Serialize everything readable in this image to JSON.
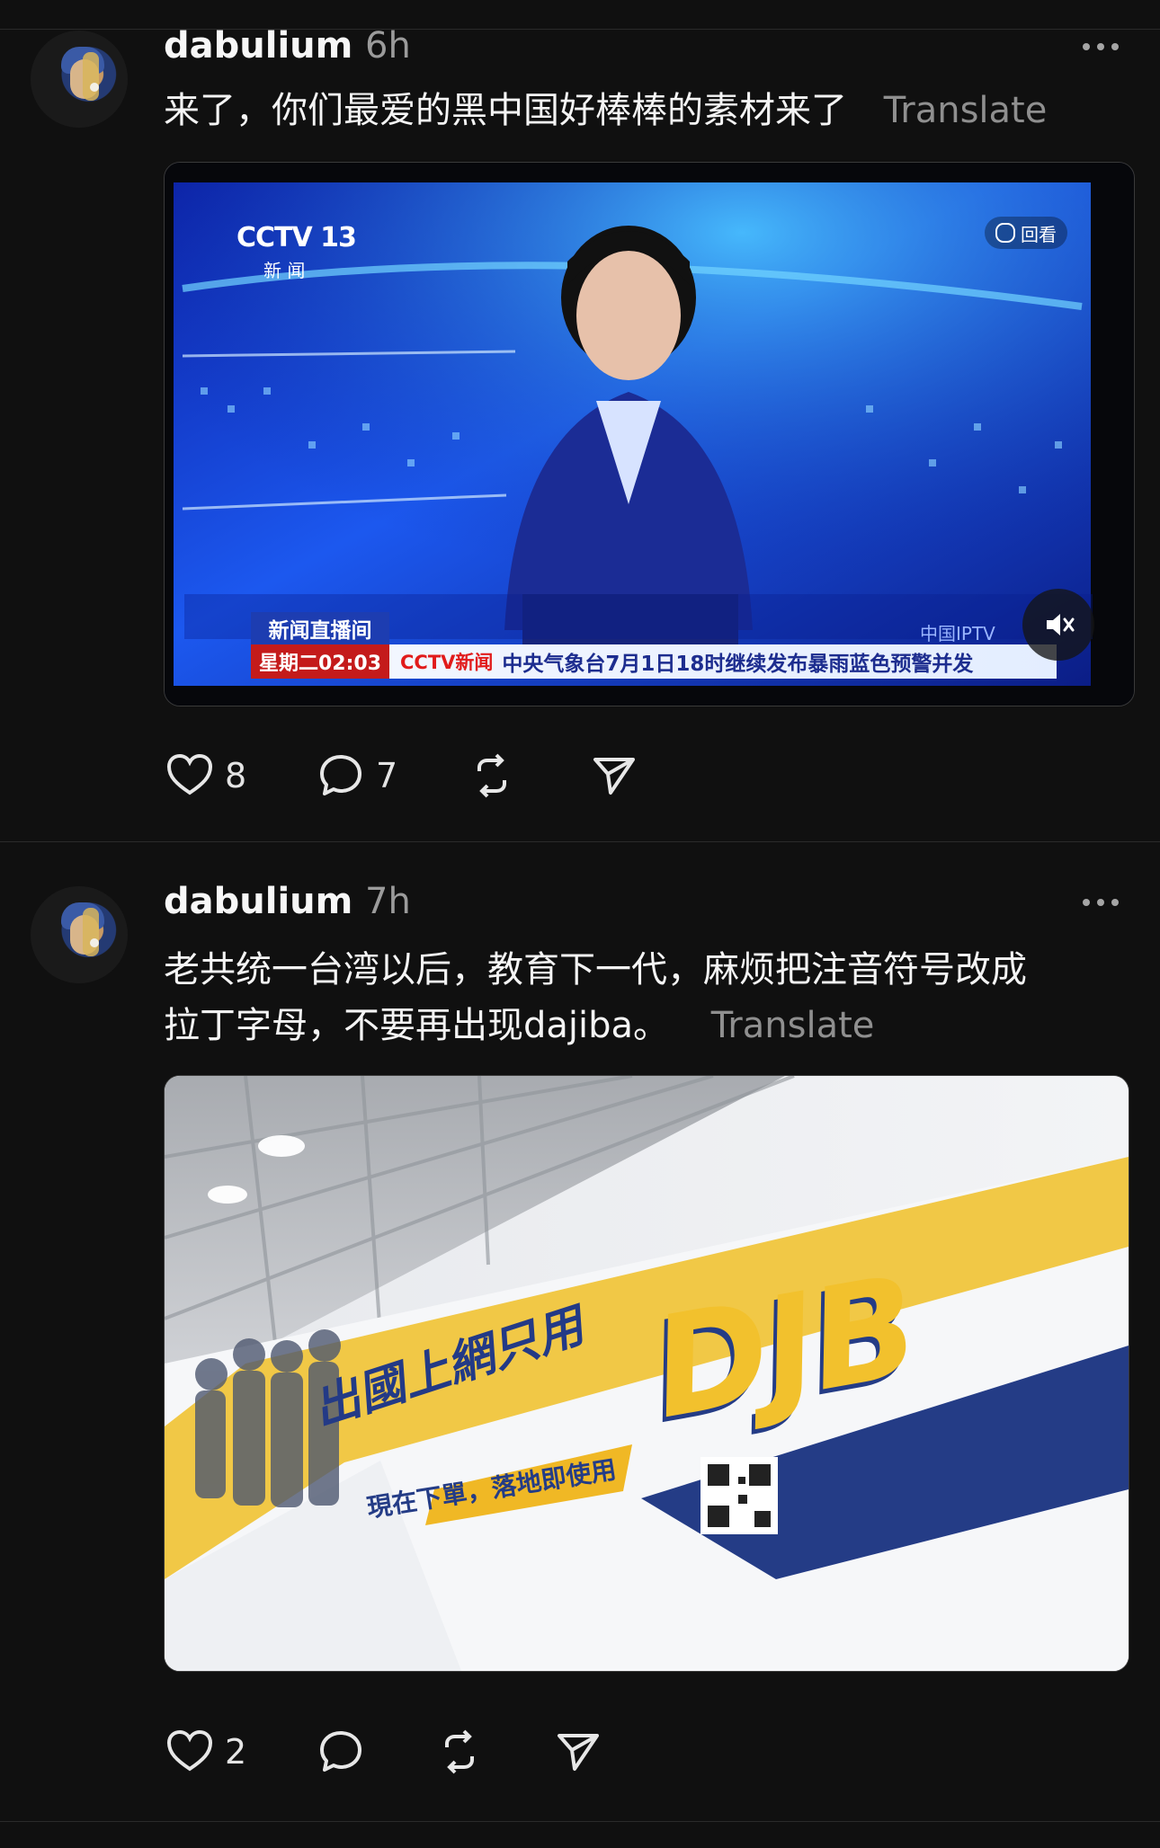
{
  "posts": [
    {
      "username": "dabulium",
      "time": "6h",
      "text": "来了，你们最爱的黑中国好棒棒的素材来了",
      "translate": "Translate",
      "video": {
        "channel_logo": "CCTV 13",
        "channel_sub": "新 闻",
        "replay_label": "回看",
        "program_label": "新闻直播间",
        "clock": "星期二02:03",
        "ticker_logo": "CCTV新闻",
        "ticker_text": "中央气象台7月1日18时继续发布暴雨蓝色预警并发",
        "iptv_label": "中国IPTV",
        "mute_icon": "mute-icon"
      },
      "likes": "8",
      "comments": "7"
    },
    {
      "username": "dabulium",
      "time": "7h",
      "text_line1": "老共统一台湾以后，教育下一代，麻烦把注音符号改成",
      "text_line2": "拉丁字母，不要再出现dajiba。",
      "translate": "Translate",
      "image": {
        "slogan": "出國上網只用",
        "brand": "DJB",
        "subslogan": "現在下單，落地即使用"
      },
      "likes": "2",
      "comments": ""
    }
  ],
  "icons": {
    "like": "heart-icon",
    "comment": "comment-icon",
    "repost": "repost-icon",
    "share": "share-icon",
    "more": "more-icon"
  },
  "colors": {
    "background": "#101010",
    "text": "#f4f4f4",
    "muted": "#8f8f8f",
    "cctv_blue": "#1845d6",
    "djb_yellow": "#f2c12d",
    "djb_navy": "#233a86"
  }
}
